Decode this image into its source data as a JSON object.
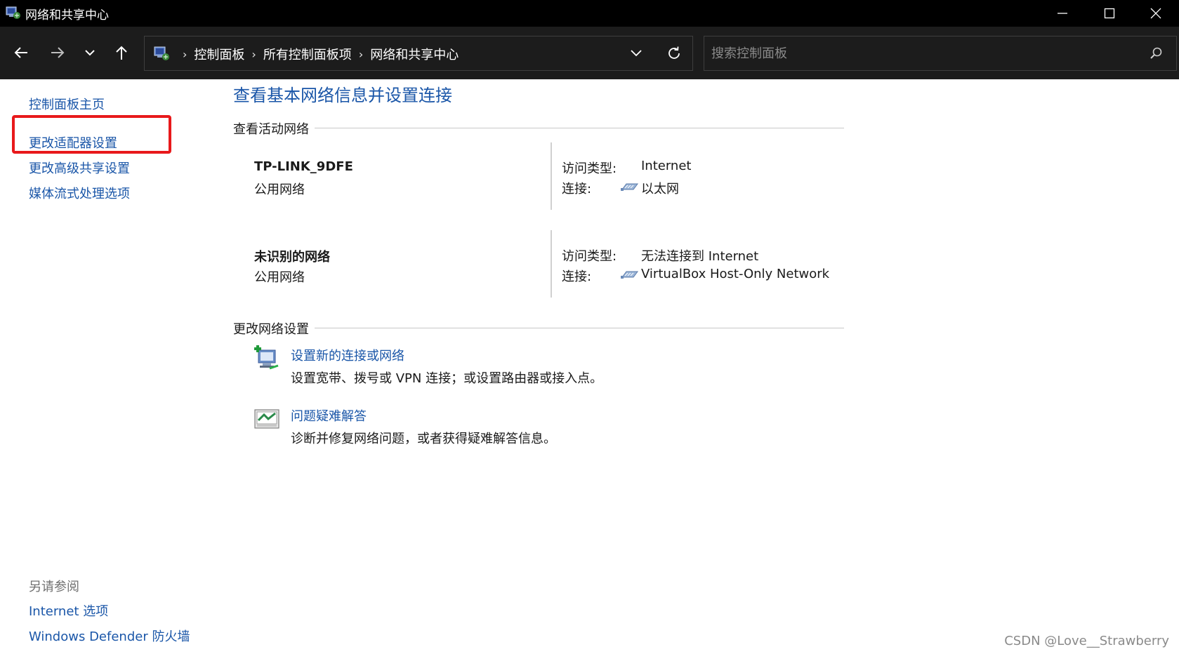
{
  "window": {
    "title": "网络和共享中心",
    "controls": [
      "minimize",
      "maximize",
      "close"
    ]
  },
  "toolbar": {
    "back": "back-arrow-icon",
    "forward": "forward-arrow-icon",
    "recent": "chevron-down-icon",
    "up": "up-arrow-icon",
    "breadcrumb": [
      "控制面板",
      "所有控制面板项",
      "网络和共享中心"
    ],
    "search_placeholder": "搜索控制面板"
  },
  "left_pane": {
    "items": [
      "控制面板主页",
      "更改适配器设置",
      "更改高级共享设置",
      "媒体流式处理选项"
    ],
    "see_also_title": "另请参阅",
    "see_also": [
      "Internet 选项",
      "Windows Defender 防火墙"
    ]
  },
  "main": {
    "title": "查看基本网络信息并设置连接",
    "active_networks_header": "查看活动网络",
    "networks": [
      {
        "name": "TP-LINK_9DFE",
        "type": "公用网络",
        "access_label": "访问类型:",
        "access_value": "Internet",
        "connection_label": "连接:",
        "connection_value": "以太网"
      },
      {
        "name": "未识别的网络",
        "type": "公用网络",
        "access_label": "访问类型:",
        "access_value": "无法连接到 Internet",
        "connection_label": "连接:",
        "connection_value": "VirtualBox Host-Only Network"
      }
    ],
    "change_settings_header": "更改网络设置",
    "tasks": [
      {
        "title": "设置新的连接或网络",
        "desc": "设置宽带、拨号或 VPN 连接；或设置路由器或接入点。",
        "icon": "new-connection-icon"
      },
      {
        "title": "问题疑难解答",
        "desc": "诊断并修复网络问题，或者获得疑难解答信息。",
        "icon": "troubleshoot-icon"
      }
    ]
  },
  "watermark": "CSDN @Love__Strawberry",
  "colors": {
    "link": "#1a56a8",
    "titlebar": "#000000",
    "toolbar": "#1c1c1c",
    "highlight": "#e8191b"
  }
}
